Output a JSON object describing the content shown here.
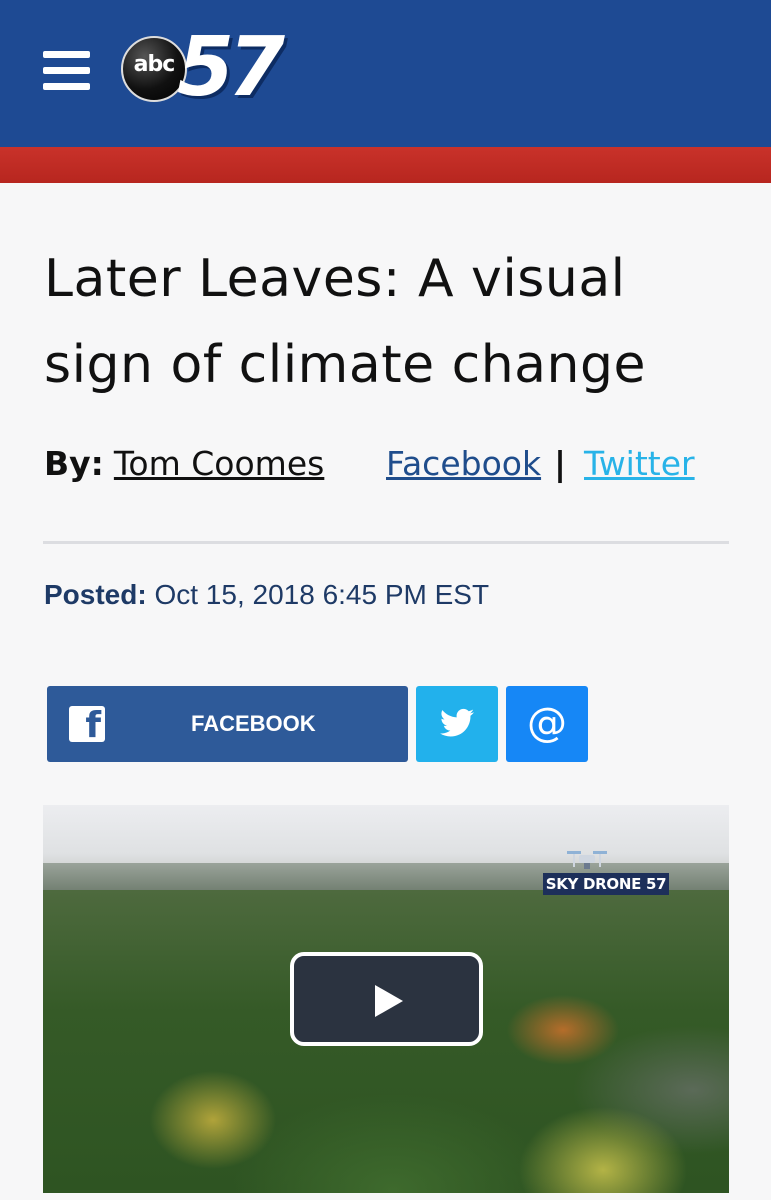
{
  "header": {
    "menu_icon": "hamburger-menu-icon",
    "logo": {
      "abc_text": "abc",
      "channel_number": "57"
    },
    "colors": {
      "header_bg": "#1e4a93",
      "accent_red": "#c9322a"
    }
  },
  "article": {
    "headline": "Later Leaves: A visual sign of climate change",
    "byline": {
      "prefix": "By:",
      "author": "Tom Coomes",
      "facebook_link": "Facebook",
      "separator": "|",
      "twitter_link": "Twitter"
    },
    "posted": {
      "label": "Posted:",
      "datetime": "Oct 15, 2018 6:45 PM EST"
    }
  },
  "share": {
    "facebook_label": "FACEBOOK",
    "facebook_icon": "facebook-icon",
    "twitter_icon": "twitter-bird-icon",
    "email_glyph": "@",
    "colors": {
      "facebook": "#2e5a99",
      "twitter": "#22b1ec",
      "email": "#1687f6"
    }
  },
  "video": {
    "badge_text": "SKY DRONE 57",
    "play_icon": "play-icon"
  }
}
